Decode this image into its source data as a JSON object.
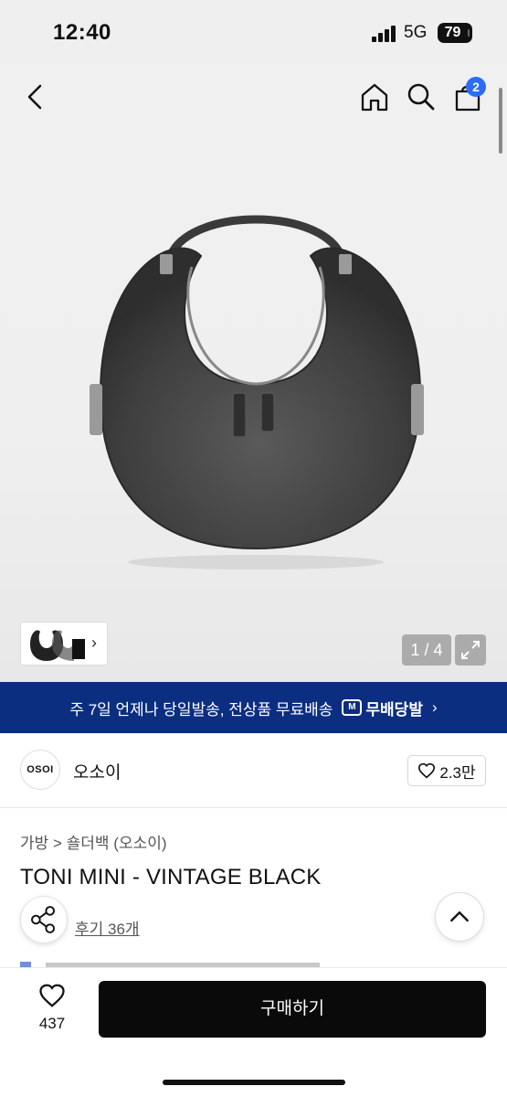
{
  "status": {
    "time": "12:40",
    "network": "5G",
    "battery": "79"
  },
  "header": {
    "cart_count": "2"
  },
  "gallery": {
    "counter": "1 / 4",
    "thumb_arrow": "›"
  },
  "banner": {
    "text": "주 7일 언제나 당일발송, 전상품 무료배송",
    "logo_text": "무배당발",
    "logo_badge": "M",
    "arrow": "›"
  },
  "brand": {
    "logo_text": "OSOI",
    "name": "오소이",
    "likes": "2.3만"
  },
  "product": {
    "breadcrumb": "가방 > 숄더백 (오소이)",
    "name": "TONI MINI - VINTAGE BLACK",
    "reviews": "후기 36개"
  },
  "bottom": {
    "wish_count": "437",
    "buy_label": "구매하기"
  },
  "colors": {
    "banner_bg": "#0b2e80",
    "badge_blue": "#2a6cf5",
    "buy_bg": "#0a0a0a"
  },
  "icons": [
    "back-icon",
    "home-icon",
    "search-icon",
    "cart-icon",
    "share-icon",
    "chevron-up-icon",
    "heart-icon",
    "expand-icon"
  ]
}
